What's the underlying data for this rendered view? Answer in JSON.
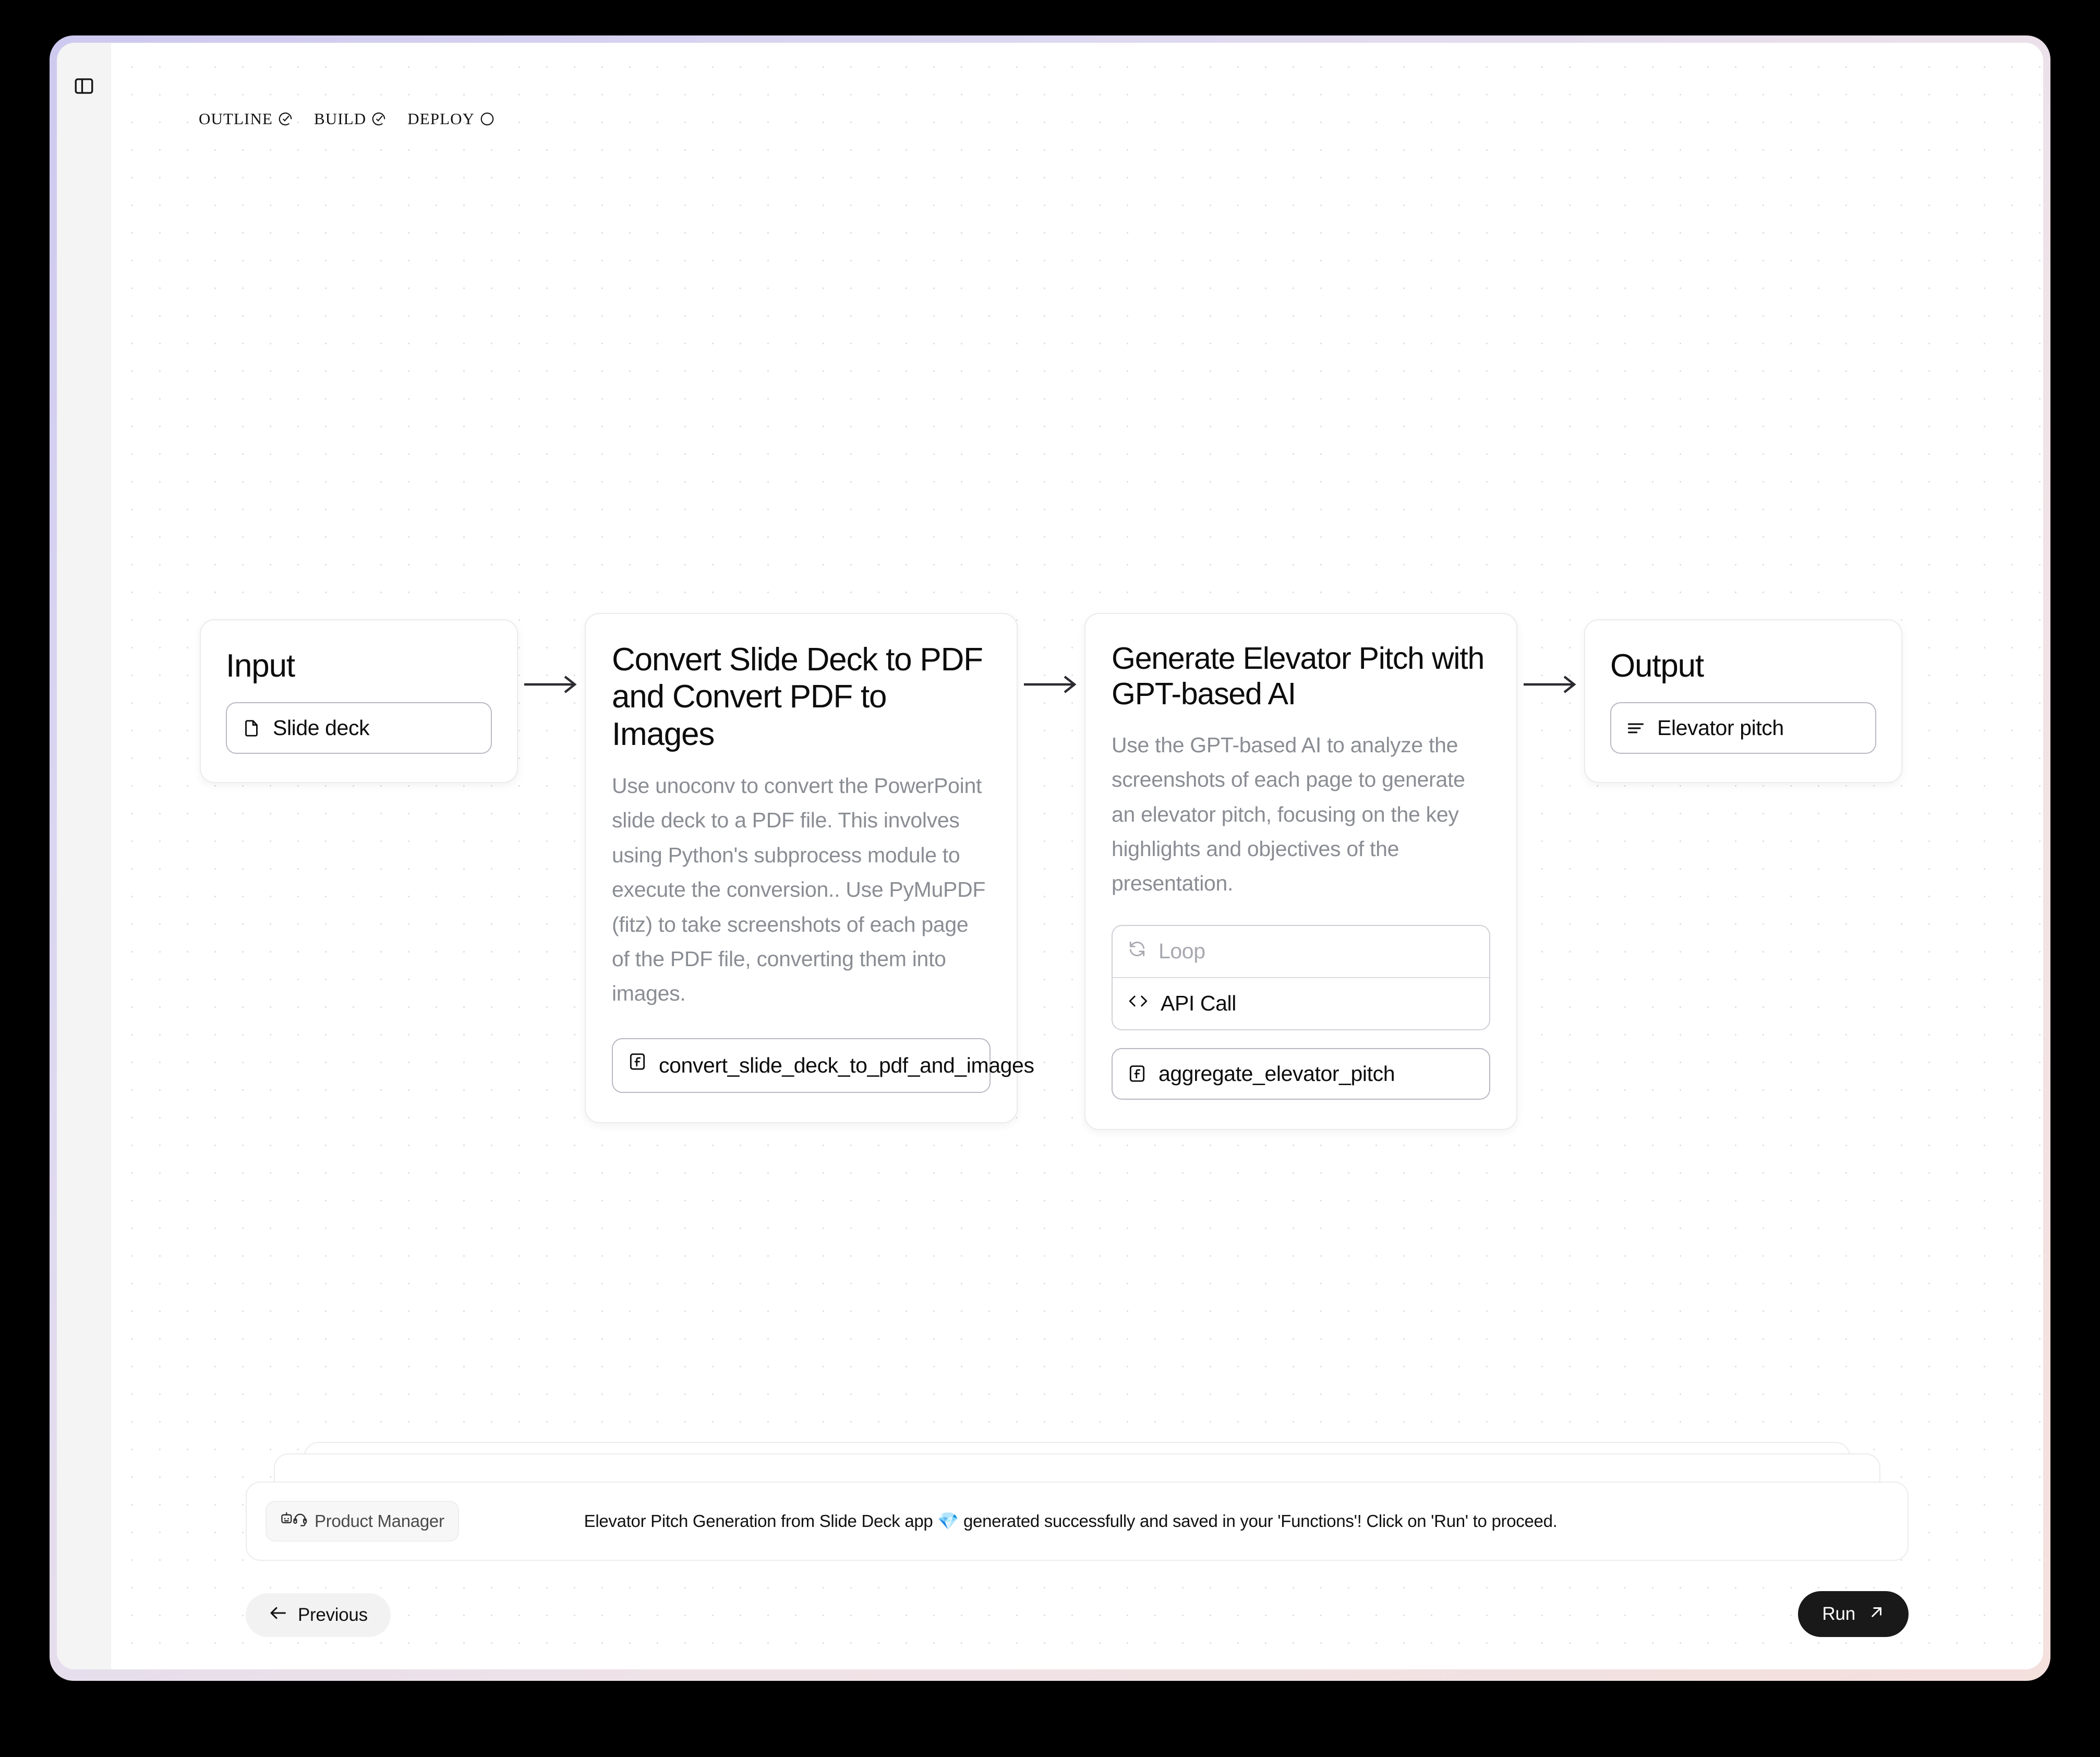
{
  "window": {
    "sidebar": {
      "toggle_icon": "panel-toggle-icon"
    },
    "steps": [
      {
        "label": "OUTLINE",
        "icon": "check-circle-icon",
        "state": "complete"
      },
      {
        "label": "BUILD",
        "icon": "check-circle-icon",
        "state": "complete"
      },
      {
        "label": "DEPLOY",
        "icon": "empty-circle-icon",
        "state": "pending"
      }
    ]
  },
  "flow": {
    "input_node": {
      "title": "Input",
      "chip": {
        "label": "Slide deck",
        "icon": "file-icon"
      }
    },
    "output_node": {
      "title": "Output",
      "chip": {
        "label": "Elevator pitch",
        "icon": "text-lines-icon"
      }
    },
    "convert_node": {
      "title": "Convert Slide Deck to PDF and Convert PDF to Images",
      "description": "Use unoconv to convert the PowerPoint slide deck to a PDF file. This involves using Python's subprocess module to execute the conversion.. Use PyMuPDF (fitz) to take screenshots of each page of the PDF file, converting them into images.",
      "function_chip": {
        "label": "convert_slide_deck_to_pdf_and_images",
        "icon": "function-icon"
      }
    },
    "generate_node": {
      "title": "Generate Elevator Pitch with GPT-based AI",
      "description": "Use the GPT-based AI to analyze the screenshots of each page to generate an elevator pitch, focusing on the key highlights and objectives of the presentation.",
      "loop_chip": {
        "label": "Loop",
        "icon": "loop-icon"
      },
      "api_chip": {
        "label": "API Call",
        "icon": "code-brackets-icon"
      },
      "function_chip": {
        "label": "aggregate_elevator_pitch",
        "icon": "function-icon"
      }
    },
    "connector_icon": "arrow-right-icon"
  },
  "dock": {
    "agent": {
      "label": "Product Manager",
      "icon": "robot-headset-icon"
    },
    "message": "Elevator Pitch Generation from Slide Deck app 💎 generated successfully and saved in your 'Functions'! Click on 'Run' to proceed.",
    "previous_button": {
      "label": "Previous",
      "icon": "arrow-left-icon"
    },
    "run_button": {
      "label": "Run",
      "icon": "arrow-up-right-icon"
    }
  },
  "colors": {
    "frame_start": "#cdc9ef",
    "frame_end": "#f4e0dd",
    "rail": "#f4f4f4",
    "muted_text": "#8a8d93",
    "run_button_bg": "#191919"
  }
}
